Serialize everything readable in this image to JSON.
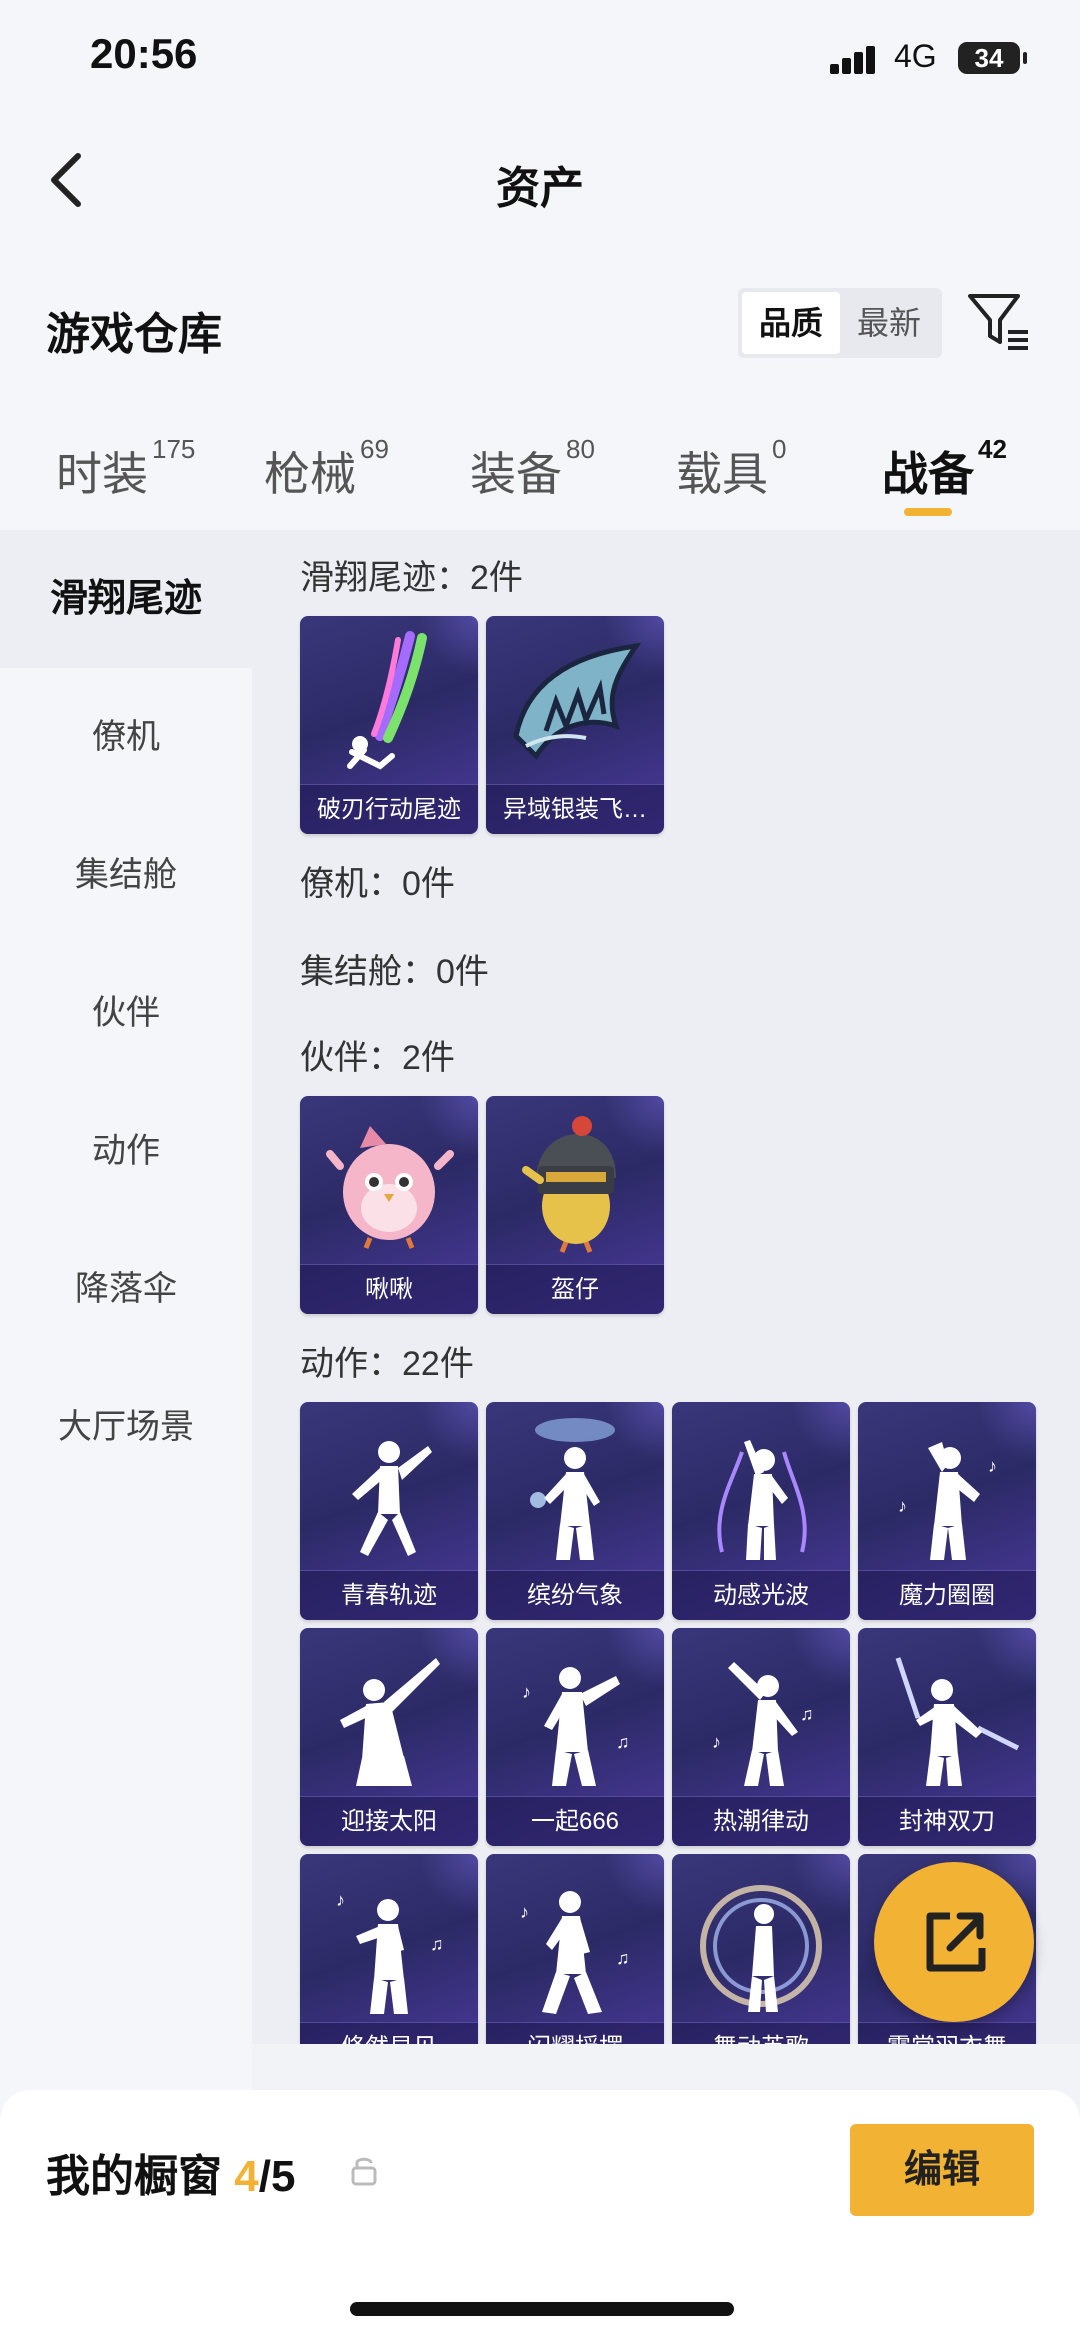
{
  "status_bar": {
    "time": "20:56",
    "network": "4G",
    "battery": "34"
  },
  "header": {
    "title": "资产"
  },
  "section": {
    "title": "游戏仓库",
    "sort_options": [
      "品质",
      "最新"
    ],
    "sort_active": "品质"
  },
  "tabs": [
    {
      "label": "时装",
      "count": "175"
    },
    {
      "label": "枪械",
      "count": "69"
    },
    {
      "label": "装备",
      "count": "80"
    },
    {
      "label": "载具",
      "count": "0"
    },
    {
      "label": "战备",
      "count": "42",
      "active": true
    }
  ],
  "sidebar": {
    "items": [
      "滑翔尾迹",
      "僚机",
      "集结舱",
      "伙伴",
      "动作",
      "降落伞",
      "大厅场景"
    ],
    "active": "滑翔尾迹"
  },
  "categories": {
    "glide_trail": {
      "label": "滑翔尾迹：2件",
      "items": [
        "破刃行动尾迹",
        "异域银装飞…"
      ]
    },
    "wingman": {
      "label": "僚机：0件"
    },
    "assembly_pod": {
      "label": "集结舱：0件"
    },
    "partner": {
      "label": "伙伴：2件",
      "items": [
        "啾啾",
        "盔仔"
      ]
    },
    "emote": {
      "label": "动作：22件",
      "items": [
        "青春轨迹",
        "缤纷气象",
        "动感光波",
        "魔力圈圈",
        "迎接太阳",
        "一起666",
        "热潮律动",
        "封神双刀",
        "倏然显见",
        "闪耀摇摆",
        "舞动英歌",
        "霓裳羽衣舞"
      ]
    }
  },
  "showcase": {
    "title": "我的橱窗",
    "current": "4",
    "total": "5",
    "separator": "/"
  },
  "buttons": {
    "edit": "编辑"
  },
  "colors": {
    "accent": "#f2b233",
    "card_bg": "#2c2a66",
    "page_bg": "#f2f3f7"
  }
}
